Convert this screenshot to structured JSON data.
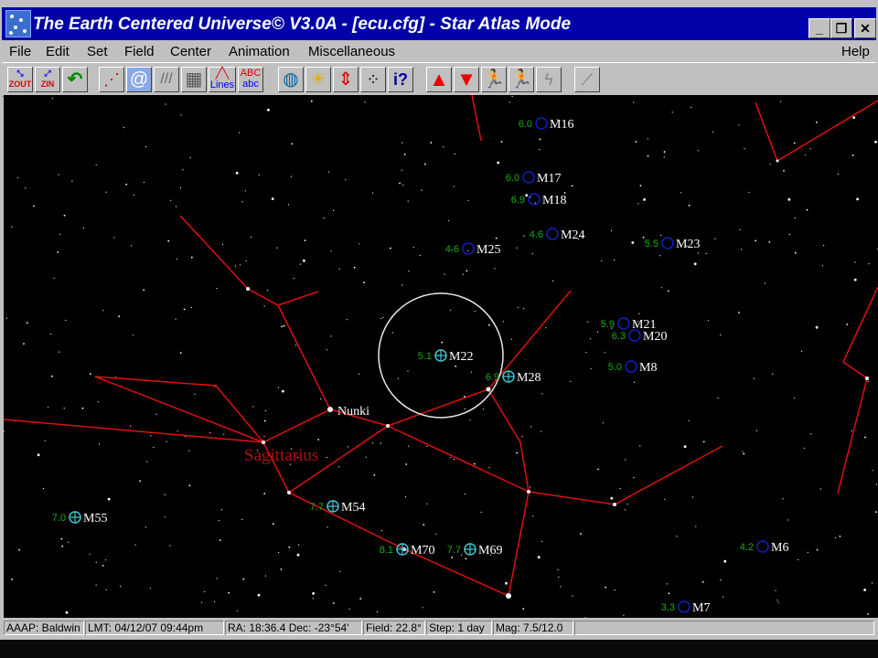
{
  "window": {
    "title": "The Earth Centered Universe© V3.0A - [ecu.cfg] - Star Atlas Mode",
    "minimize_icon": "minimize-icon",
    "restore_icon": "restore-icon",
    "close_icon": "close-icon"
  },
  "menu": {
    "items": [
      "File",
      "Edit",
      "Set",
      "Field",
      "Center",
      "Animation",
      "Miscellaneous"
    ],
    "help": "Help"
  },
  "toolbar": {
    "zoom_out": "ZOUT",
    "zoom_in": "ZIN",
    "lines": "Lines",
    "abc_top": "ABC",
    "abc_bottom": "abc",
    "icons": [
      "zoom-out-icon",
      "zoom-in-icon",
      "undo-icon",
      "constellation-lines-icon",
      "galaxy-icon",
      "milky-way-icon",
      "grid-icon",
      "lines-icon",
      "labels-icon",
      "globe-icon",
      "sun-icon",
      "horizon-icon",
      "stars-icon",
      "info-icon",
      "up-arrow-icon",
      "down-arrow-icon",
      "step-back-icon",
      "step-forward-icon",
      "lightning-icon",
      "telescope-icon"
    ]
  },
  "sky": {
    "constellation_label": "Sagittarius",
    "star_label": "Nunki",
    "objects": [
      {
        "name": "M16",
        "mag": "6.0",
        "kind": "cluster"
      },
      {
        "name": "M17",
        "mag": "6.0",
        "kind": "cluster"
      },
      {
        "name": "M18",
        "mag": "6.9",
        "kind": "cluster"
      },
      {
        "name": "M24",
        "mag": "4.6",
        "kind": "cluster"
      },
      {
        "name": "M25",
        "mag": "4.6",
        "kind": "cluster"
      },
      {
        "name": "M23",
        "mag": "5.5",
        "kind": "cluster"
      },
      {
        "name": "M21",
        "mag": "5.9",
        "kind": "cluster"
      },
      {
        "name": "M20",
        "mag": "6.3",
        "kind": "cluster"
      },
      {
        "name": "M8",
        "mag": "5.0",
        "kind": "cluster"
      },
      {
        "name": "M22",
        "mag": "5.1",
        "kind": "globular"
      },
      {
        "name": "M28",
        "mag": "6.9",
        "kind": "globular"
      },
      {
        "name": "M55",
        "mag": "7.0",
        "kind": "globular"
      },
      {
        "name": "M54",
        "mag": "7.7",
        "kind": "globular"
      },
      {
        "name": "M70",
        "mag": "8.1",
        "kind": "globular"
      },
      {
        "name": "M69",
        "mag": "7.7",
        "kind": "globular"
      },
      {
        "name": "M6",
        "mag": "4.2",
        "kind": "cluster"
      },
      {
        "name": "M7",
        "mag": "3.3",
        "kind": "cluster"
      }
    ],
    "colors": {
      "lines": "#e01010",
      "globular": "#40c8d0",
      "cluster": "#1020c0",
      "mag": "#10b010",
      "label": "#ffffff",
      "constellation": "#b01010"
    }
  },
  "status": {
    "location": "AAAP: Baldwin",
    "time": "LMT: 04/12/07 09:44pm",
    "coords": "RA: 18:36.4  Dec: -23°54'",
    "field": "Field: 22.8°",
    "step": "Step: 1 day",
    "mag": "Mag: 7.5/12.0"
  }
}
